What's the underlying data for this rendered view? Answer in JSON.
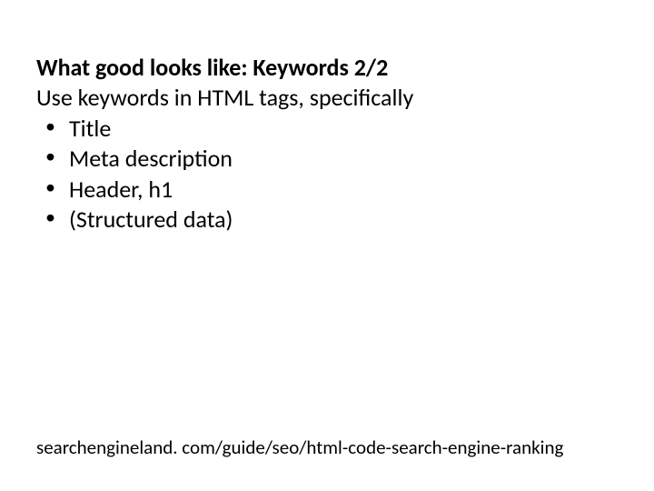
{
  "slide": {
    "title": "What good looks like: Keywords 2/2",
    "subtitle": "Use keywords in HTML tags, specifically",
    "bullets": [
      "Title",
      "Meta description",
      "Header, h1",
      "(Structured data)"
    ],
    "footer": "searchengineland. com/guide/seo/html-code-search-engine-ranking"
  }
}
